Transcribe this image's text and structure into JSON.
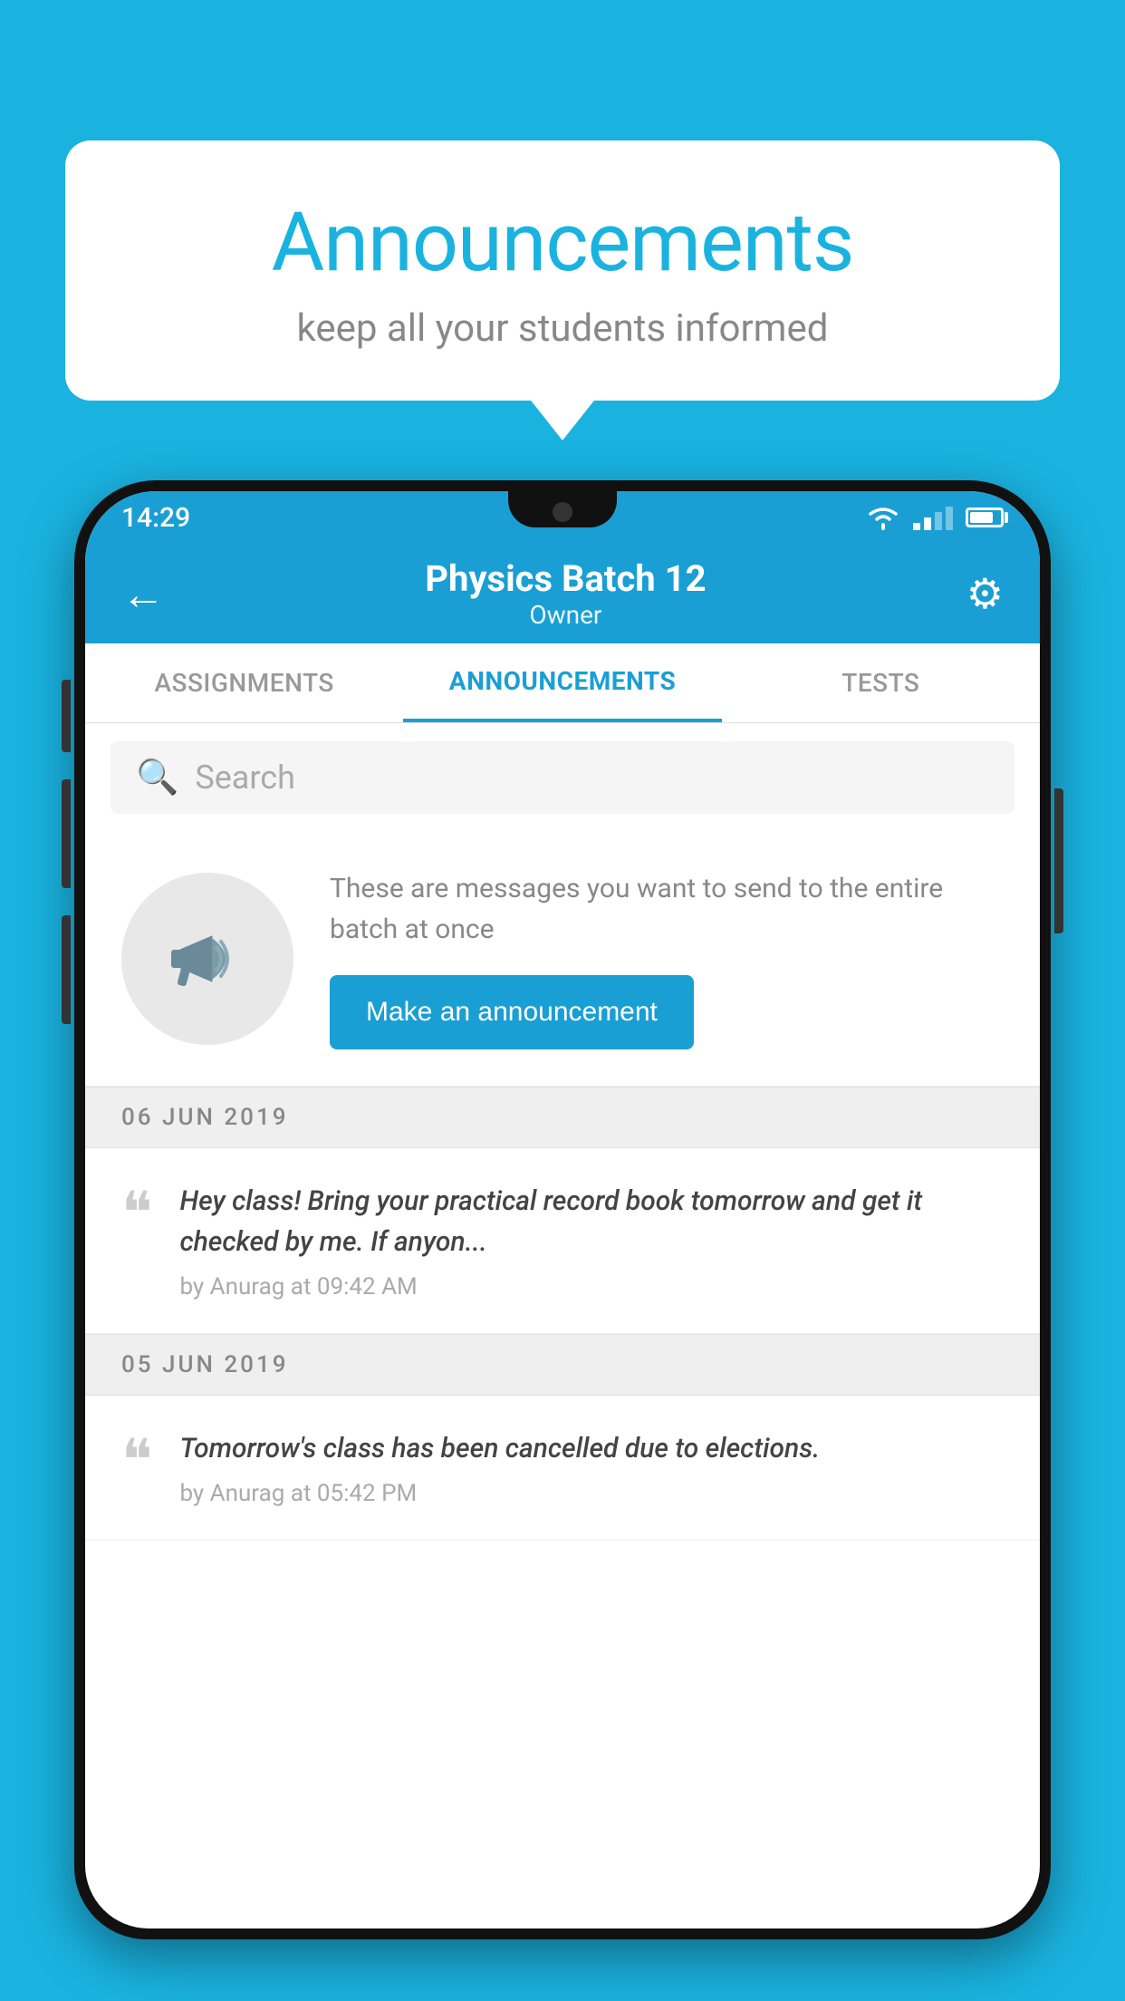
{
  "background_color": "#1ab3e0",
  "speech_bubble": {
    "title": "Announcements",
    "subtitle": "keep all your students informed"
  },
  "phone": {
    "status_bar": {
      "time": "14:29"
    },
    "top_bar": {
      "title": "Physics Batch 12",
      "subtitle": "Owner",
      "back_label": "←",
      "gear_label": "⚙"
    },
    "tabs": [
      {
        "label": "ASSIGNMENTS",
        "active": false
      },
      {
        "label": "ANNOUNCEMENTS",
        "active": true
      },
      {
        "label": "TESTS",
        "active": false
      }
    ],
    "search": {
      "placeholder": "Search"
    },
    "promo": {
      "description": "These are messages you want to send to the entire batch at once",
      "button_label": "Make an announcement"
    },
    "announcements": [
      {
        "date": "06  JUN  2019",
        "message": "Hey class! Bring your practical record book tomorrow and get it checked by me. If anyon...",
        "meta": "by Anurag at 09:42 AM"
      },
      {
        "date": "05  JUN  2019",
        "message": "Tomorrow's class has been cancelled due to elections.",
        "meta": "by Anurag at 05:42 PM"
      }
    ]
  }
}
